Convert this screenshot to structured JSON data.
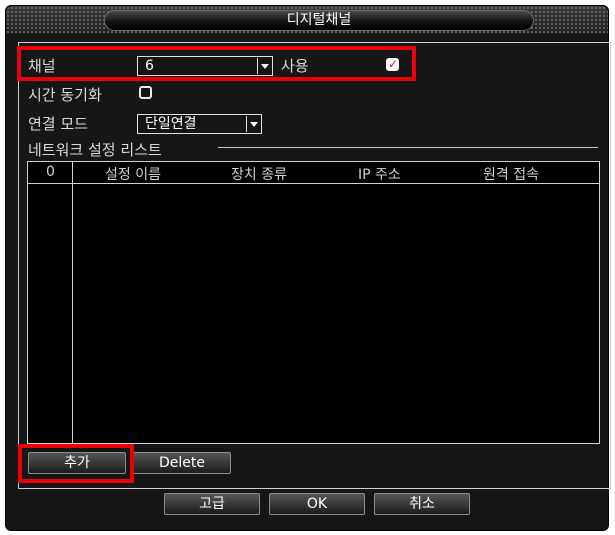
{
  "window": {
    "title": "디지털채널"
  },
  "channel": {
    "label": "채널",
    "value": "6",
    "enable_label": "사용",
    "enabled": true
  },
  "time_sync": {
    "label": "시간 동기화",
    "checked": false
  },
  "connect_mode": {
    "label": "연결 모드",
    "value": "단일연결"
  },
  "network_list": {
    "label": "네트워크 설정 리스트",
    "columns": [
      "0",
      "설정 이름",
      "장치 종류",
      "IP 주소",
      "원격 접속"
    ],
    "rows": []
  },
  "list_buttons": {
    "add": "추가",
    "delete": "Delete"
  },
  "footer_buttons": {
    "advanced": "고급",
    "ok": "OK",
    "cancel": "취소"
  },
  "colors": {
    "highlight": "#e8000a",
    "background": "#161616",
    "text": "#d9d9d9"
  }
}
